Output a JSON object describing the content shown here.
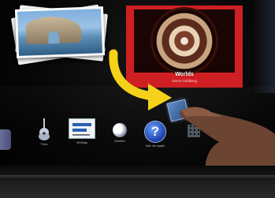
{
  "album": {
    "title": "Worlds",
    "artist": "Aaron Goldberg",
    "color": "#cf1f22"
  },
  "photos": {
    "subject": "sea arch rock photo"
  },
  "dock": {
    "items": [
      {
        "label": "",
        "icon": "partial-icon"
      },
      {
        "label": "Trios",
        "icon": "guitar-icon"
      },
      {
        "label": "Writings",
        "icon": "document-icon"
      },
      {
        "label": "Models",
        "icon": "moon-icon"
      },
      {
        "label": "Ask me again",
        "icon": "help-icon"
      },
      {
        "label": "",
        "icon": "grid-icon"
      }
    ]
  },
  "arrow": {
    "color": "#f5d21a"
  },
  "dragged_item": {
    "icon": "album-thumbnail-icon",
    "color": "#4a7bbd"
  }
}
